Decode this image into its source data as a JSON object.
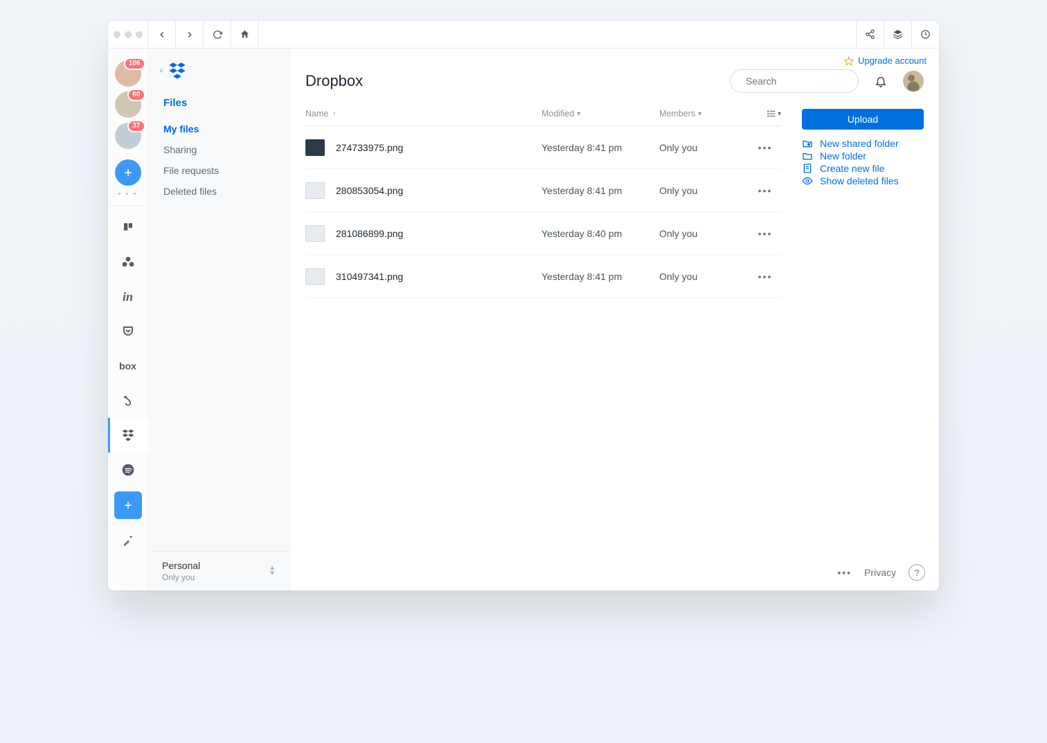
{
  "rail": {
    "avatars": [
      {
        "badge": "106"
      },
      {
        "badge": "60"
      },
      {
        "badge": "37"
      }
    ],
    "apps": [
      {
        "id": "trello",
        "active": false
      },
      {
        "id": "asana",
        "active": false
      },
      {
        "id": "invision",
        "active": false
      },
      {
        "id": "pocket",
        "active": false
      },
      {
        "id": "box",
        "active": false
      },
      {
        "id": "bonsai",
        "active": false
      },
      {
        "id": "dropbox",
        "active": true
      },
      {
        "id": "spotify",
        "active": false
      }
    ]
  },
  "sidebar": {
    "section_title": "Files",
    "items": [
      {
        "label": "My files",
        "active": true
      },
      {
        "label": "Sharing",
        "active": false
      },
      {
        "label": "File requests",
        "active": false
      },
      {
        "label": "Deleted files",
        "active": false
      }
    ],
    "account": {
      "title": "Personal",
      "sub": "Only you"
    }
  },
  "header": {
    "upgrade_label": "Upgrade account",
    "page_title": "Dropbox",
    "search_placeholder": "Search"
  },
  "table": {
    "columns": {
      "name": "Name",
      "modified": "Modified",
      "members": "Members"
    },
    "rows": [
      {
        "name": "274733975.png",
        "modified": "Yesterday 8:41 pm",
        "members": "Only you",
        "thumb": "dark"
      },
      {
        "name": "280853054.png",
        "modified": "Yesterday 8:41 pm",
        "members": "Only you",
        "thumb": "light"
      },
      {
        "name": "281086899.png",
        "modified": "Yesterday 8:40 pm",
        "members": "Only you",
        "thumb": "light"
      },
      {
        "name": "310497341.png",
        "modified": "Yesterday 8:41 pm",
        "members": "Only you",
        "thumb": "light"
      }
    ]
  },
  "actions": {
    "upload": "Upload",
    "links": [
      {
        "id": "new-shared-folder",
        "label": "New shared folder"
      },
      {
        "id": "new-folder",
        "label": "New folder"
      },
      {
        "id": "create-new-file",
        "label": "Create new file"
      },
      {
        "id": "show-deleted",
        "label": "Show deleted files"
      }
    ]
  },
  "footer": {
    "privacy": "Privacy"
  }
}
